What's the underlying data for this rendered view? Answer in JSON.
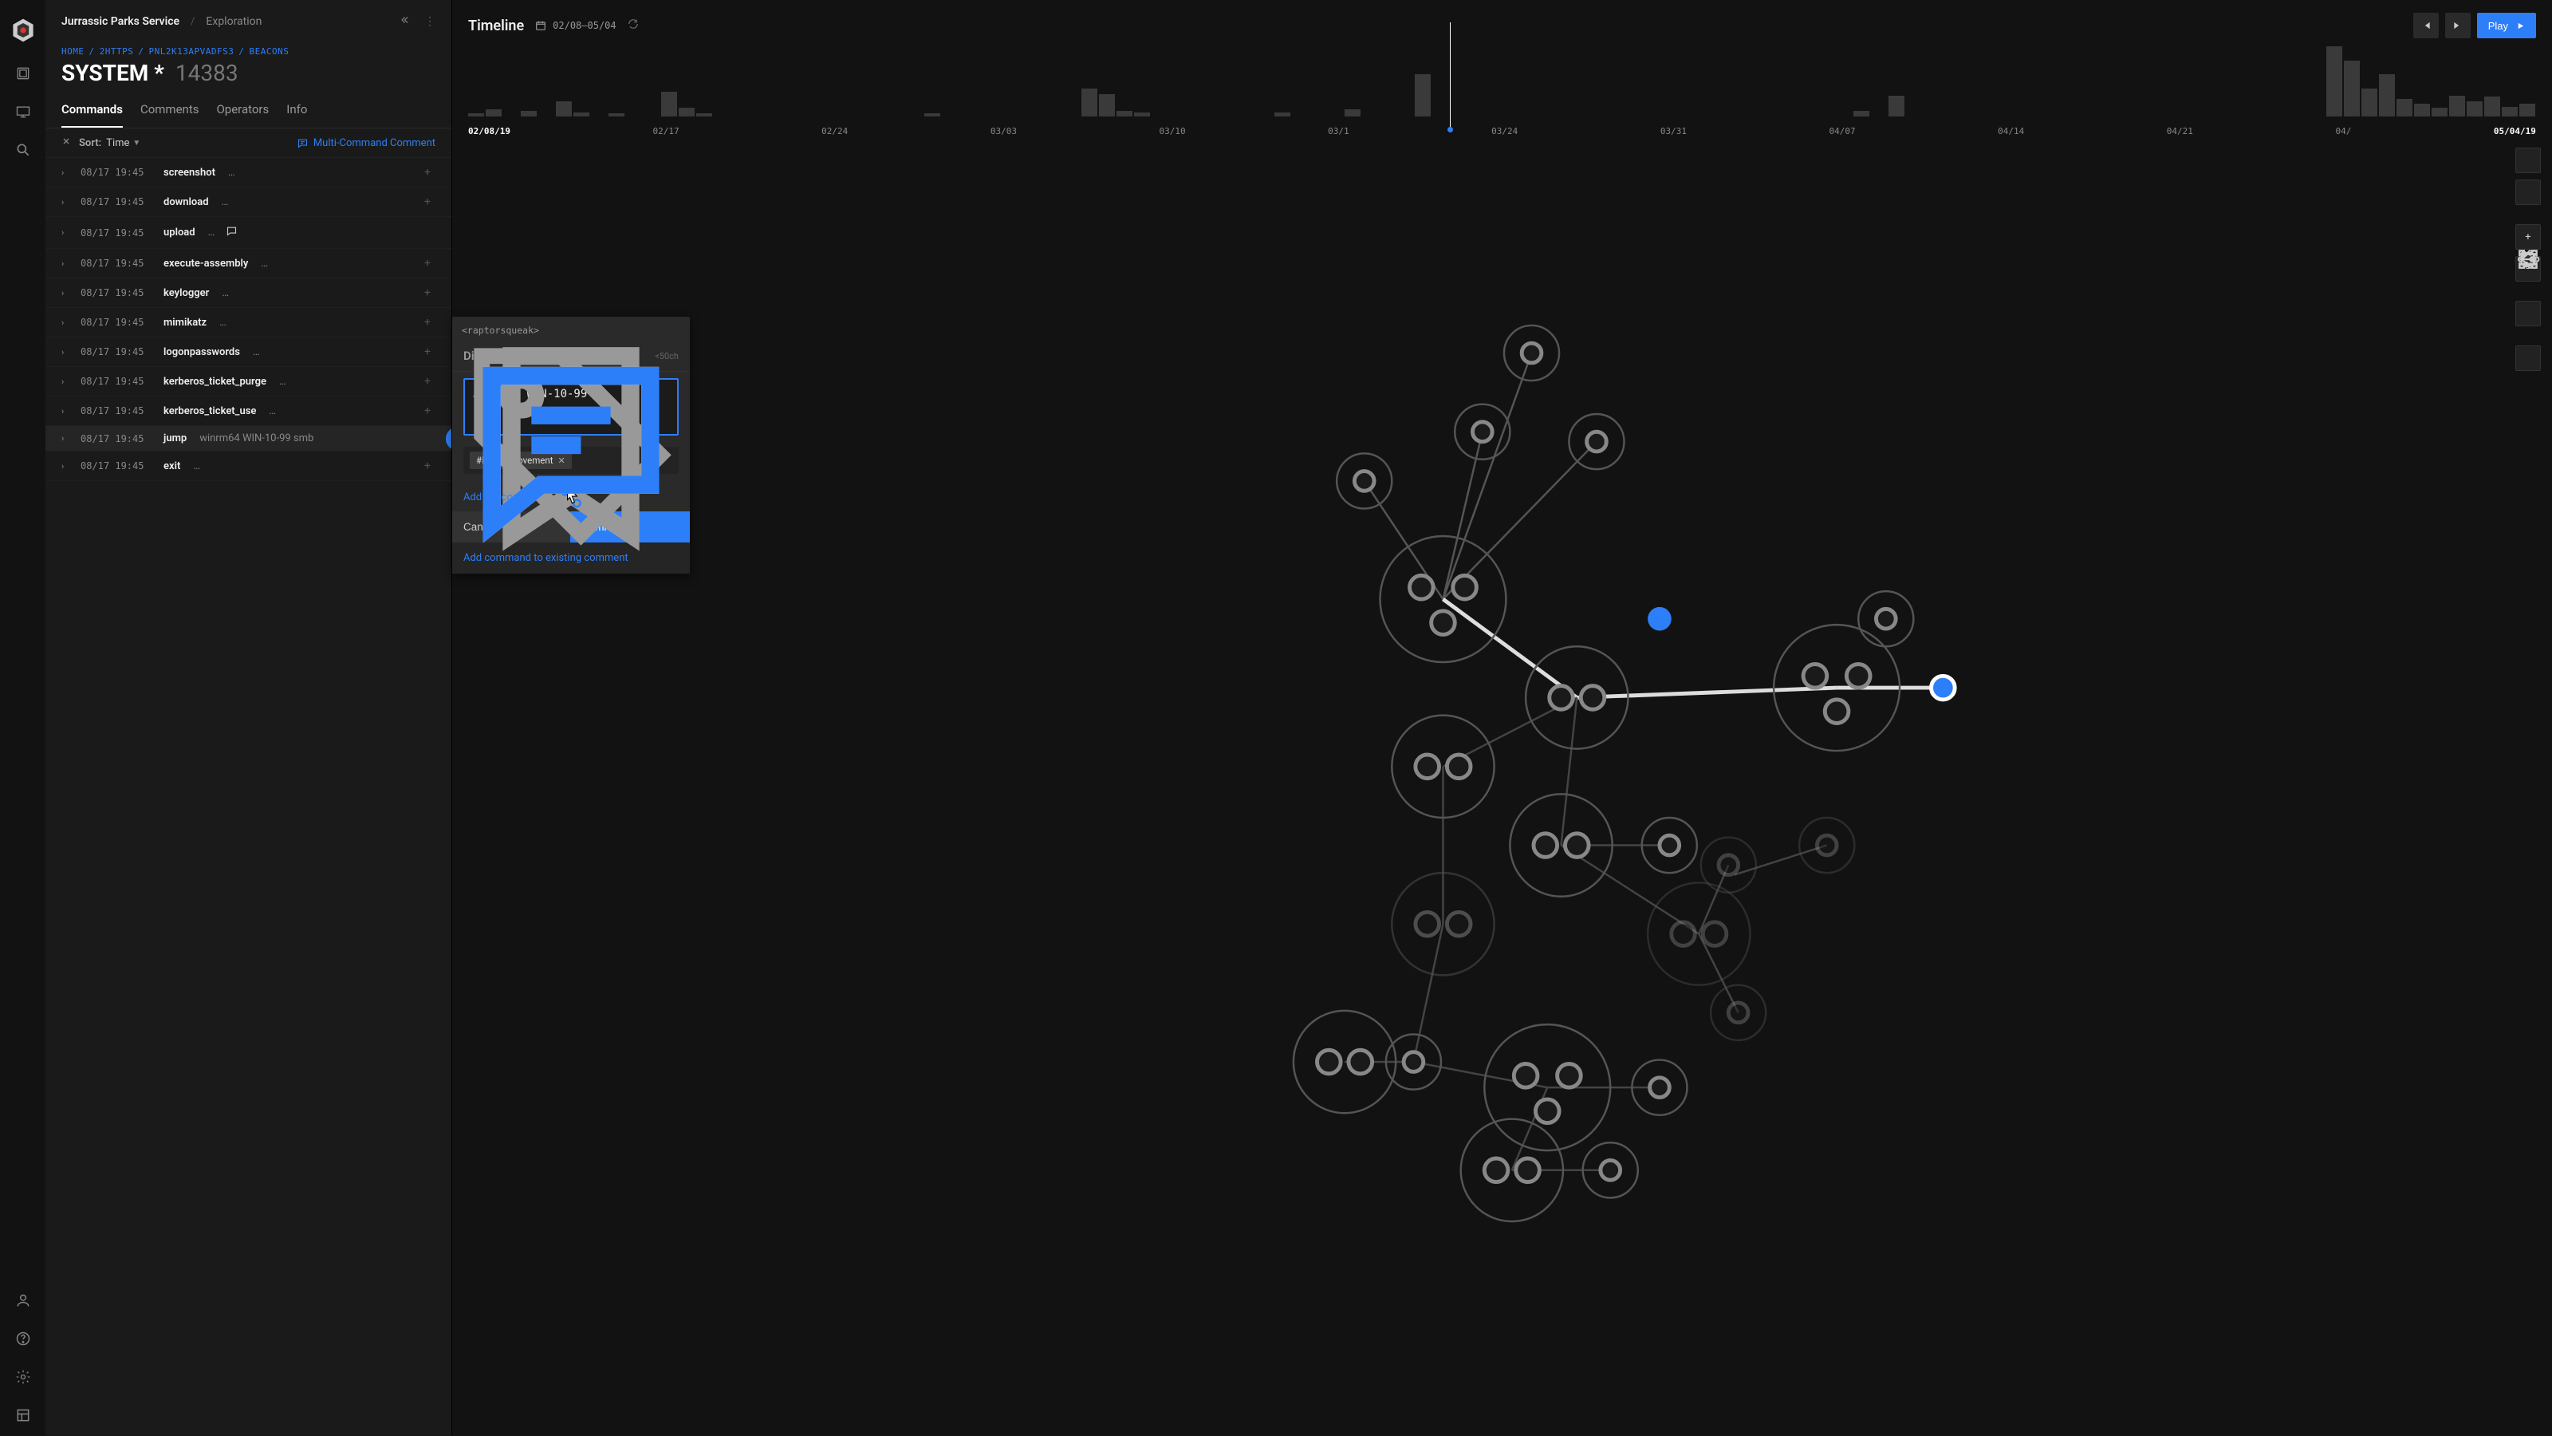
{
  "header": {
    "org": "Jurrassic Parks Service",
    "mode": "Exploration"
  },
  "breadcrumb": [
    "HOME",
    "2HTTPS",
    "PNL2K13APVADFS3",
    "BEACONS"
  ],
  "title": {
    "name": "SYSTEM *",
    "id": "14383"
  },
  "tabs": [
    "Commands",
    "Comments",
    "Operators",
    "Info"
  ],
  "active_tab": "Commands",
  "sort": {
    "label": "Sort:",
    "value": "Time"
  },
  "multi_comment_label": "Multi-Command Comment",
  "commands": [
    {
      "ts": "08/17 19:45",
      "name": "screenshot",
      "args": "…"
    },
    {
      "ts": "08/17 19:45",
      "name": "download",
      "args": "…"
    },
    {
      "ts": "08/17 19:45",
      "name": "upload",
      "args": "…",
      "has_comment_icon": true
    },
    {
      "ts": "08/17 19:45",
      "name": "execute-assembly",
      "args": "…"
    },
    {
      "ts": "08/17 19:45",
      "name": "keylogger",
      "args": "…"
    },
    {
      "ts": "08/17 19:45",
      "name": "mimikatz",
      "args": "…"
    },
    {
      "ts": "08/17 19:45",
      "name": "logonpasswords",
      "args": "…"
    },
    {
      "ts": "08/17 19:45",
      "name": "kerberos_ticket_purge",
      "args": "…"
    },
    {
      "ts": "08/17 19:45",
      "name": "kerberos_ticket_use",
      "args": "…"
    },
    {
      "ts": "08/17 19:45",
      "name": "jump",
      "args": "winrm64 WIN-10-99 smb",
      "selected": true
    },
    {
      "ts": "08/17 19:45",
      "name": "exit",
      "args": "…"
    }
  ],
  "timeline": {
    "title": "Timeline",
    "range": "02/08–05/04",
    "ticks": [
      "02/08/19",
      "02/17",
      "02/24",
      "03/03",
      "03/10",
      "03/1",
      "03/24",
      "03/31",
      "04/07",
      "04/14",
      "04/21",
      "04/",
      "05/04/19"
    ],
    "play_label": "Play"
  },
  "chart_data": {
    "type": "bar",
    "note": "relative activity counts per day bucket; exact values estimated from bar pixel heights on 0–100 scale",
    "values": [
      5,
      10,
      0,
      8,
      0,
      22,
      6,
      0,
      4,
      0,
      0,
      35,
      12,
      5,
      0,
      0,
      0,
      0,
      0,
      0,
      0,
      0,
      0,
      0,
      0,
      0,
      4,
      0,
      0,
      0,
      0,
      0,
      0,
      0,
      0,
      40,
      32,
      8,
      6,
      0,
      0,
      0,
      0,
      0,
      0,
      0,
      6,
      0,
      0,
      0,
      10,
      0,
      0,
      0,
      60,
      0,
      0,
      0,
      0,
      0,
      0,
      0,
      0,
      0,
      0,
      0,
      0,
      0,
      0,
      0,
      0,
      0,
      0,
      0,
      0,
      0,
      0,
      0,
      0,
      8,
      0,
      30,
      0,
      0,
      0,
      0,
      0,
      0,
      0,
      0,
      0,
      0,
      0,
      0,
      0,
      0,
      0,
      0,
      0,
      0,
      0,
      0,
      0,
      0,
      0,
      0,
      100,
      80,
      40,
      60,
      25,
      18,
      12,
      30,
      22,
      28,
      14,
      18
    ],
    "ylim": [
      0,
      100
    ],
    "marker_index": 56
  },
  "popover": {
    "user": "<raptorsqueak>",
    "title": "Display Name",
    "limit": "<50ch",
    "input_value": "Jump to WIN-10-99",
    "tag": "#LateralMovement",
    "add_link": "Add beacon link",
    "cancel": "Cancel",
    "submit": "Comment",
    "add_existing": "Add command to existing comment"
  }
}
